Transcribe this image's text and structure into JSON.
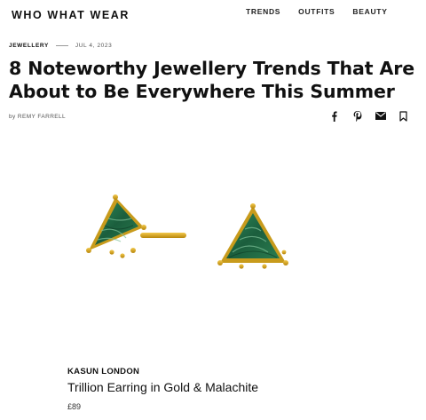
{
  "site": {
    "logo": "WHO WHAT WEAR"
  },
  "nav": {
    "items": [
      "TRENDS",
      "OUTFITS",
      "BEAUTY"
    ]
  },
  "article": {
    "category": "JEWELLERY",
    "date": "JUL 4, 2023",
    "title": "8 Noteworthy Jewellery Trends That Are About to Be Everywhere This Summer",
    "by_prefix": "by",
    "author": "REMY FARRELL"
  },
  "share": {
    "icons": [
      "facebook-icon",
      "pinterest-icon",
      "email-icon",
      "bookmark-icon"
    ]
  },
  "product": {
    "brand": "KASUN LONDON",
    "name": "Trillion Earring in Gold & Malachite",
    "price": "£89"
  },
  "colors": {
    "malachite": "#1f6b45",
    "gold": "#d4a21a",
    "text": "#111111"
  }
}
